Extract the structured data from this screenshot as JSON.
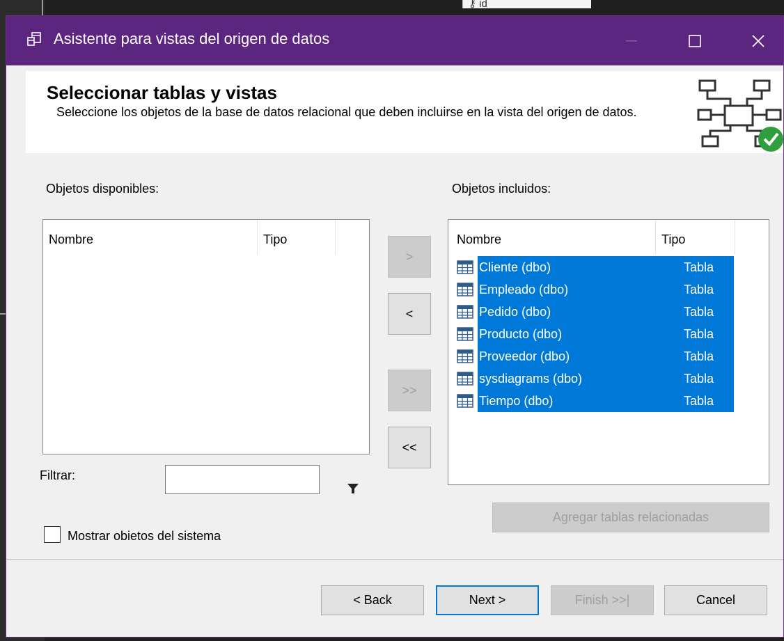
{
  "window": {
    "title": "Asistente para vistas del origen de datos",
    "accent_color": "#5c2580"
  },
  "background": {
    "id_snippet": "id"
  },
  "header": {
    "title": "Seleccionar tablas y vistas",
    "description": "Seleccione los objetos de la base de datos relacional que deben incluirse en la vista del origen de datos.",
    "icon": "schema-check-icon"
  },
  "available": {
    "label": "Objetos disponibles:",
    "columns": [
      "Nombre",
      "Tipo"
    ],
    "rows": []
  },
  "included": {
    "label": "Objetos incluidos:",
    "columns": [
      "Nombre",
      "Tipo"
    ],
    "rows": [
      {
        "name": "Cliente (dbo)",
        "type": "Tabla"
      },
      {
        "name": "Empleado (dbo)",
        "type": "Tabla"
      },
      {
        "name": "Pedido (dbo)",
        "type": "Tabla"
      },
      {
        "name": "Producto (dbo)",
        "type": "Tabla"
      },
      {
        "name": "Proveedor (dbo)",
        "type": "Tabla"
      },
      {
        "name": "sysdiagrams (dbo)",
        "type": "Tabla"
      },
      {
        "name": "Tiempo (dbo)",
        "type": "Tabla"
      }
    ],
    "selection_color": "#0078d7"
  },
  "transfer": {
    "add": ">",
    "remove": "<",
    "add_all": ">>",
    "remove_all": "<<"
  },
  "filter": {
    "label": "Filtrar:",
    "value": ""
  },
  "related_button": "Agregar tablas relacionadas",
  "show_system": {
    "label": "Mostrar obietos del sistema",
    "checked": false
  },
  "footer": {
    "back": "< Back",
    "next": "Next >",
    "finish": "Finish >>|",
    "cancel": "Cancel"
  }
}
